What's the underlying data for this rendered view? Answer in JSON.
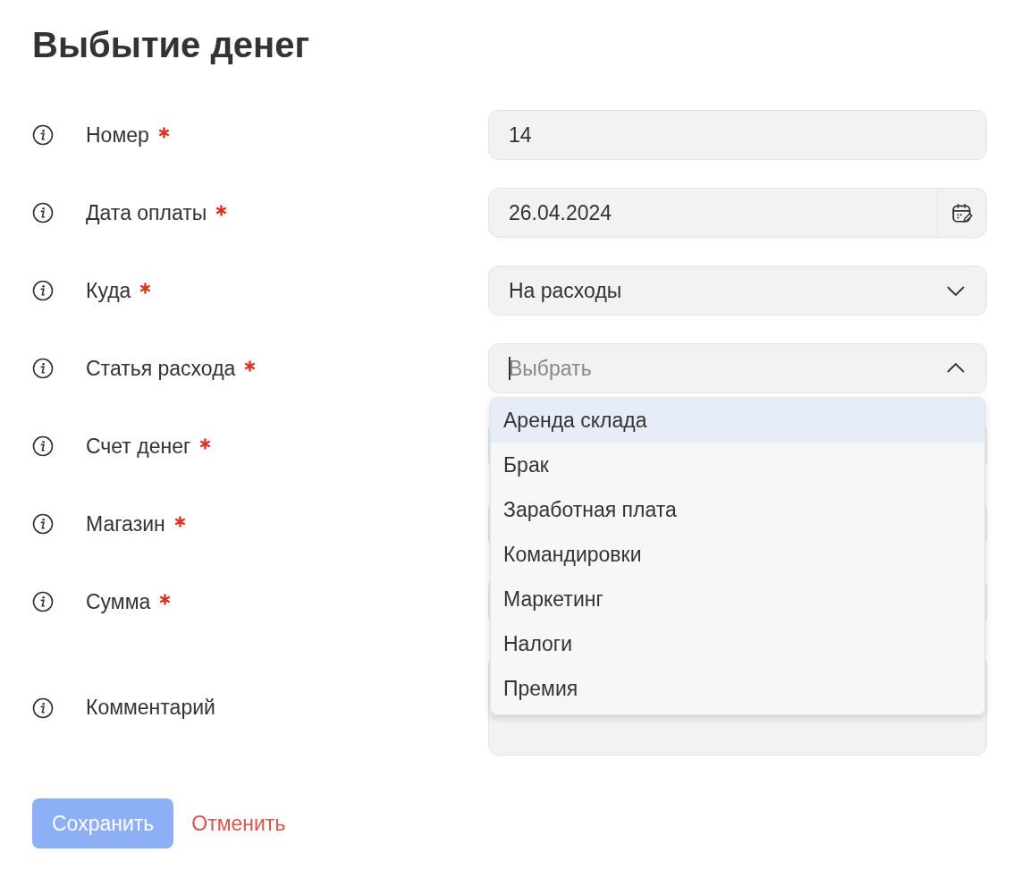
{
  "title": "Выбытие денег",
  "fields": [
    {
      "label": "Номер",
      "required": true,
      "kind": "text",
      "value": "14"
    },
    {
      "label": "Дата оплаты",
      "required": true,
      "kind": "date",
      "value": "26.04.2024"
    },
    {
      "label": "Куда",
      "required": true,
      "kind": "select",
      "value": "На расходы",
      "expanded": false
    },
    {
      "label": "Статья расхода",
      "required": true,
      "kind": "select",
      "placeholder": "Выбрать",
      "expanded": true,
      "options": [
        {
          "label": "Аренда склада",
          "selected": true
        },
        {
          "label": "Брак",
          "selected": false
        },
        {
          "label": "Заработная плата",
          "selected": false
        },
        {
          "label": "Командировки",
          "selected": false
        },
        {
          "label": "Маркетинг",
          "selected": false
        },
        {
          "label": "Налоги",
          "selected": false
        },
        {
          "label": "Премия",
          "selected": false
        }
      ]
    },
    {
      "label": "Счет денег",
      "required": true,
      "kind": "text"
    },
    {
      "label": "Магазин",
      "required": true,
      "kind": "text"
    },
    {
      "label": "Сумма",
      "required": true,
      "kind": "text"
    },
    {
      "label": "Комментарий",
      "required": false,
      "kind": "textarea"
    }
  ],
  "buttons": {
    "save": {
      "label": "Сохранить",
      "disabled": true
    },
    "cancel": {
      "label": "Отменить"
    }
  }
}
